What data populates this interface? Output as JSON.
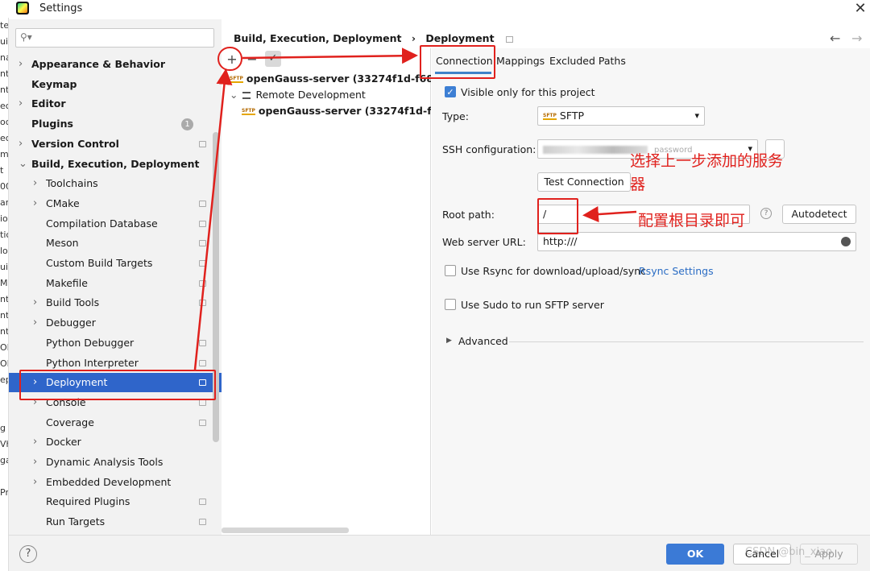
{
  "window": {
    "title": "Settings",
    "close_glyph": "✕"
  },
  "left_edge_fragments": [
    "te",
    "uil",
    "na",
    "nt",
    "nt",
    "ec",
    "ocl",
    "ec",
    "mp",
    "t",
    "00",
    "ar",
    "io",
    "tic",
    "lo",
    "uil",
    "Ma",
    "nt",
    "nt",
    "nt",
    "ON",
    "OF",
    "ep",
    "",
    "",
    "g",
    "Vh",
    "ga",
    "",
    "Pr"
  ],
  "sidebar": {
    "search_placeholder": "",
    "search_icon": "search-icon",
    "items": [
      {
        "label": "Appearance & Behavior",
        "bold": true,
        "chevron": "›",
        "indent": 0
      },
      {
        "label": "Keymap",
        "bold": true,
        "chevron": "",
        "indent": 0
      },
      {
        "label": "Editor",
        "bold": true,
        "chevron": "›",
        "indent": 0
      },
      {
        "label": "Plugins",
        "bold": true,
        "chevron": "",
        "indent": 0,
        "badge": "1"
      },
      {
        "label": "Version Control",
        "bold": true,
        "chevron": "›",
        "indent": 0,
        "config": true
      },
      {
        "label": "Build, Execution, Deployment",
        "bold": true,
        "chevron": "⌄",
        "indent": 0
      },
      {
        "label": "Toolchains",
        "chevron": "›",
        "indent": 1
      },
      {
        "label": "CMake",
        "chevron": "›",
        "indent": 1,
        "config": true
      },
      {
        "label": "Compilation Database",
        "chevron": "",
        "indent": 1,
        "config": true
      },
      {
        "label": "Meson",
        "chevron": "",
        "indent": 1,
        "config": true
      },
      {
        "label": "Custom Build Targets",
        "chevron": "",
        "indent": 1,
        "config": true
      },
      {
        "label": "Makefile",
        "chevron": "",
        "indent": 1,
        "config": true
      },
      {
        "label": "Build Tools",
        "chevron": "›",
        "indent": 1,
        "config": true
      },
      {
        "label": "Debugger",
        "chevron": "›",
        "indent": 1
      },
      {
        "label": "Python Debugger",
        "chevron": "",
        "indent": 1,
        "config": true
      },
      {
        "label": "Python Interpreter",
        "chevron": "",
        "indent": 1,
        "config": true
      },
      {
        "label": "Deployment",
        "chevron": "›",
        "indent": 1,
        "config": true,
        "selected": true
      },
      {
        "label": "Console",
        "chevron": "›",
        "indent": 1,
        "config": true
      },
      {
        "label": "Coverage",
        "chevron": "",
        "indent": 1,
        "config": true
      },
      {
        "label": "Docker",
        "chevron": "›",
        "indent": 1
      },
      {
        "label": "Dynamic Analysis Tools",
        "chevron": "›",
        "indent": 1
      },
      {
        "label": "Embedded Development",
        "chevron": "›",
        "indent": 1
      },
      {
        "label": "Required Plugins",
        "chevron": "",
        "indent": 1,
        "config": true
      },
      {
        "label": "Run Targets",
        "chevron": "",
        "indent": 1,
        "config": true
      }
    ]
  },
  "breadcrumb": {
    "part1": "Build, Execution, Deployment",
    "sep": "›",
    "part2": "Deployment"
  },
  "nav": {
    "back": "←",
    "forward": "→"
  },
  "server_toolbar": {
    "add": "+",
    "remove": "−",
    "check": "✓"
  },
  "server_tree": [
    {
      "label": "openGauss-server (33274f1d-f68f-4",
      "bold": true,
      "sftp": true,
      "indent": 0
    },
    {
      "label": "Remote Development",
      "bold": false,
      "chevron": "⌄",
      "indent": 0,
      "group": true
    },
    {
      "label": "openGauss-server (33274f1d-f68f",
      "bold": true,
      "sftp": true,
      "indent": 1
    }
  ],
  "tabs": [
    "Connection",
    "Mappings",
    "Excluded Paths"
  ],
  "connection": {
    "visible_only_label": "Visible only for this project",
    "visible_only_checked": true,
    "type_label": "Type:",
    "type_value": "SFTP",
    "sftp_badge": "SFTP",
    "ssh_label": "SSH configuration:",
    "ssh_value_blurred": "password",
    "test_connection": "Test Connection",
    "root_path_label": "Root path:",
    "root_path_value": "/",
    "autodetect": "Autodetect",
    "web_url_label": "Web server URL:",
    "web_url_value": "http:///",
    "rsync_label": "Use Rsync for download/upload/sync",
    "rsync_link": "Rsync Settings",
    "sudo_label": "Use Sudo to run SFTP server",
    "advanced_label": "Advanced",
    "help_glyph": "?",
    "globe_icon": "globe-icon",
    "caret": "▾"
  },
  "annotations": {
    "select_server": "选择上一步添加的服务",
    "select_server_line2": "器",
    "root_hint": "配置根目录即可",
    "color": "#e0211d"
  },
  "footer": {
    "help": "?",
    "ok": "OK",
    "cancel": "Cancel",
    "apply": "Apply",
    "watermark": "CSDN @bin_xiao"
  },
  "colors": {
    "selection": "#2f65ca",
    "accent": "#3b7ad6",
    "annotation": "#e0211d"
  }
}
